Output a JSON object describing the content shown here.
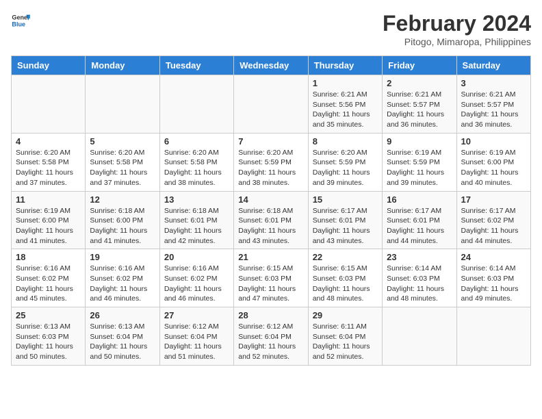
{
  "header": {
    "logo_general": "General",
    "logo_blue": "Blue",
    "month_year": "February 2024",
    "location": "Pitogo, Mimaropa, Philippines"
  },
  "days_of_week": [
    "Sunday",
    "Monday",
    "Tuesday",
    "Wednesday",
    "Thursday",
    "Friday",
    "Saturday"
  ],
  "weeks": [
    [
      {
        "day": "",
        "info": ""
      },
      {
        "day": "",
        "info": ""
      },
      {
        "day": "",
        "info": ""
      },
      {
        "day": "",
        "info": ""
      },
      {
        "day": "1",
        "info": "Sunrise: 6:21 AM\nSunset: 5:56 PM\nDaylight: 11 hours and 35 minutes."
      },
      {
        "day": "2",
        "info": "Sunrise: 6:21 AM\nSunset: 5:57 PM\nDaylight: 11 hours and 36 minutes."
      },
      {
        "day": "3",
        "info": "Sunrise: 6:21 AM\nSunset: 5:57 PM\nDaylight: 11 hours and 36 minutes."
      }
    ],
    [
      {
        "day": "4",
        "info": "Sunrise: 6:20 AM\nSunset: 5:58 PM\nDaylight: 11 hours and 37 minutes."
      },
      {
        "day": "5",
        "info": "Sunrise: 6:20 AM\nSunset: 5:58 PM\nDaylight: 11 hours and 37 minutes."
      },
      {
        "day": "6",
        "info": "Sunrise: 6:20 AM\nSunset: 5:58 PM\nDaylight: 11 hours and 38 minutes."
      },
      {
        "day": "7",
        "info": "Sunrise: 6:20 AM\nSunset: 5:59 PM\nDaylight: 11 hours and 38 minutes."
      },
      {
        "day": "8",
        "info": "Sunrise: 6:20 AM\nSunset: 5:59 PM\nDaylight: 11 hours and 39 minutes."
      },
      {
        "day": "9",
        "info": "Sunrise: 6:19 AM\nSunset: 5:59 PM\nDaylight: 11 hours and 39 minutes."
      },
      {
        "day": "10",
        "info": "Sunrise: 6:19 AM\nSunset: 6:00 PM\nDaylight: 11 hours and 40 minutes."
      }
    ],
    [
      {
        "day": "11",
        "info": "Sunrise: 6:19 AM\nSunset: 6:00 PM\nDaylight: 11 hours and 41 minutes."
      },
      {
        "day": "12",
        "info": "Sunrise: 6:18 AM\nSunset: 6:00 PM\nDaylight: 11 hours and 41 minutes."
      },
      {
        "day": "13",
        "info": "Sunrise: 6:18 AM\nSunset: 6:01 PM\nDaylight: 11 hours and 42 minutes."
      },
      {
        "day": "14",
        "info": "Sunrise: 6:18 AM\nSunset: 6:01 PM\nDaylight: 11 hours and 43 minutes."
      },
      {
        "day": "15",
        "info": "Sunrise: 6:17 AM\nSunset: 6:01 PM\nDaylight: 11 hours and 43 minutes."
      },
      {
        "day": "16",
        "info": "Sunrise: 6:17 AM\nSunset: 6:01 PM\nDaylight: 11 hours and 44 minutes."
      },
      {
        "day": "17",
        "info": "Sunrise: 6:17 AM\nSunset: 6:02 PM\nDaylight: 11 hours and 44 minutes."
      }
    ],
    [
      {
        "day": "18",
        "info": "Sunrise: 6:16 AM\nSunset: 6:02 PM\nDaylight: 11 hours and 45 minutes."
      },
      {
        "day": "19",
        "info": "Sunrise: 6:16 AM\nSunset: 6:02 PM\nDaylight: 11 hours and 46 minutes."
      },
      {
        "day": "20",
        "info": "Sunrise: 6:16 AM\nSunset: 6:02 PM\nDaylight: 11 hours and 46 minutes."
      },
      {
        "day": "21",
        "info": "Sunrise: 6:15 AM\nSunset: 6:03 PM\nDaylight: 11 hours and 47 minutes."
      },
      {
        "day": "22",
        "info": "Sunrise: 6:15 AM\nSunset: 6:03 PM\nDaylight: 11 hours and 48 minutes."
      },
      {
        "day": "23",
        "info": "Sunrise: 6:14 AM\nSunset: 6:03 PM\nDaylight: 11 hours and 48 minutes."
      },
      {
        "day": "24",
        "info": "Sunrise: 6:14 AM\nSunset: 6:03 PM\nDaylight: 11 hours and 49 minutes."
      }
    ],
    [
      {
        "day": "25",
        "info": "Sunrise: 6:13 AM\nSunset: 6:03 PM\nDaylight: 11 hours and 50 minutes."
      },
      {
        "day": "26",
        "info": "Sunrise: 6:13 AM\nSunset: 6:04 PM\nDaylight: 11 hours and 50 minutes."
      },
      {
        "day": "27",
        "info": "Sunrise: 6:12 AM\nSunset: 6:04 PM\nDaylight: 11 hours and 51 minutes."
      },
      {
        "day": "28",
        "info": "Sunrise: 6:12 AM\nSunset: 6:04 PM\nDaylight: 11 hours and 52 minutes."
      },
      {
        "day": "29",
        "info": "Sunrise: 6:11 AM\nSunset: 6:04 PM\nDaylight: 11 hours and 52 minutes."
      },
      {
        "day": "",
        "info": ""
      },
      {
        "day": "",
        "info": ""
      }
    ]
  ]
}
